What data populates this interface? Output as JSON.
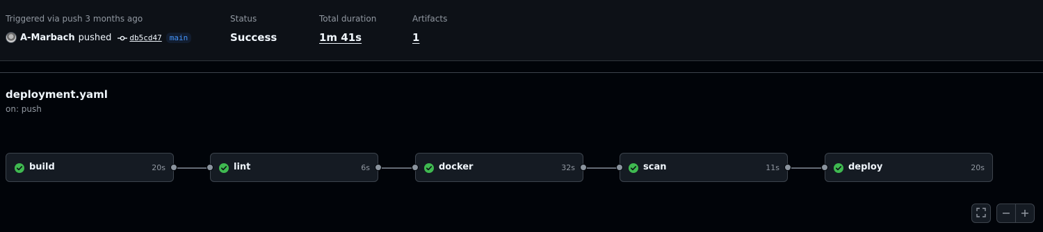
{
  "summary": {
    "trigger_label": "Triggered via push 3 months ago",
    "actor": "A-Marbach",
    "action": "pushed",
    "commit_sha": "db5cd47",
    "branch": "main",
    "status_label": "Status",
    "status_value": "Success",
    "duration_label": "Total duration",
    "duration_value": "1m 41s",
    "artifacts_label": "Artifacts",
    "artifacts_value": "1"
  },
  "workflow": {
    "file": "deployment.yaml",
    "trigger": "on: push"
  },
  "jobs": [
    {
      "name": "build",
      "duration": "20s",
      "status": "success"
    },
    {
      "name": "lint",
      "duration": "6s",
      "status": "success"
    },
    {
      "name": "docker",
      "duration": "32s",
      "status": "success"
    },
    {
      "name": "scan",
      "duration": "11s",
      "status": "success"
    },
    {
      "name": "deploy",
      "duration": "20s",
      "status": "success"
    }
  ],
  "controls": {
    "fullscreen_icon": "fullscreen-icon",
    "zoom_out_icon": "minus-icon",
    "zoom_in_icon": "plus-icon"
  },
  "colors": {
    "success": "#3fb950",
    "link_blue": "#4493f8",
    "background": "#010409"
  }
}
